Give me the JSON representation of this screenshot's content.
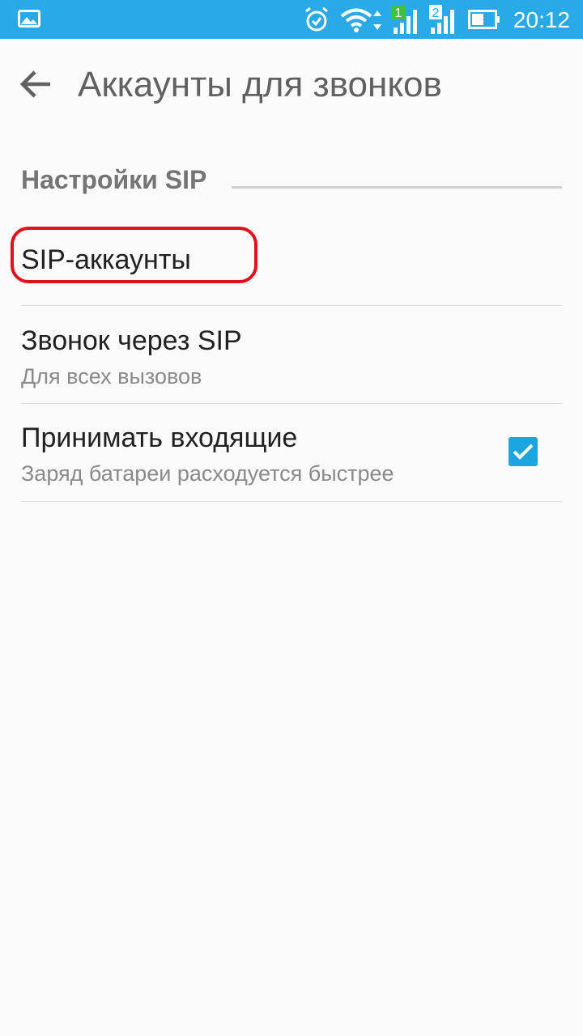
{
  "status_bar": {
    "time": "20:12",
    "icons": [
      "gallery-icon",
      "alarm-icon",
      "wifi-icon",
      "sim1-signal-icon",
      "sim2-signal-icon",
      "battery-icon"
    ],
    "sim1_label": "1",
    "sim2_label": "2",
    "background_color": "#29a9e6"
  },
  "app_bar": {
    "back_icon": "arrow-back-icon",
    "title": "Аккаунты для звонков"
  },
  "section": {
    "title": "Настройки SIP"
  },
  "preferences": [
    {
      "title": "SIP-аккаунты",
      "summary": "",
      "highlighted": true,
      "highlight_color": "#e0101f"
    },
    {
      "title": "Звонок через SIP",
      "summary": "Для всех вызовов"
    },
    {
      "title": "Принимать входящие",
      "summary": "Заряд батареи расходуется быстрее",
      "checked": true,
      "checkbox_color": "#1aa4e0"
    }
  ]
}
